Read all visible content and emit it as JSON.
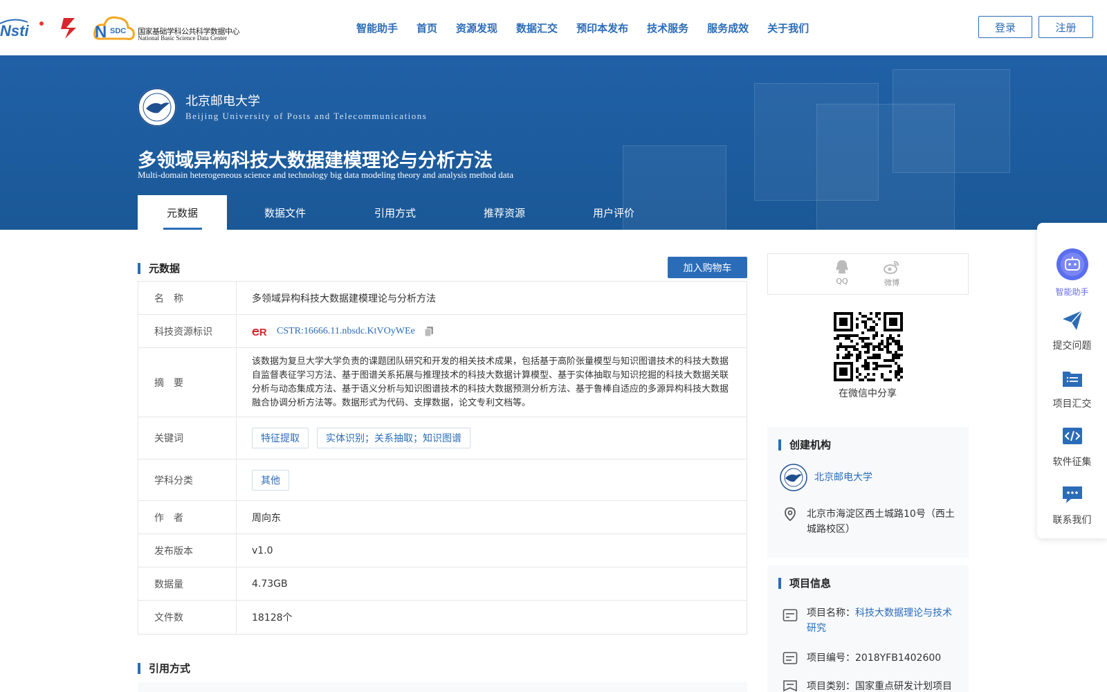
{
  "header": {
    "nsdc_cn": "国家基础学科公共科学数据中心",
    "nsdc_en": "National Basic Science Data Center",
    "nav": [
      "智能助手",
      "首页",
      "资源发现",
      "数据汇交",
      "预印本发布",
      "技术服务",
      "服务成效",
      "关于我们"
    ],
    "login": "登录",
    "register": "注册"
  },
  "banner": {
    "institution_cn": "北京邮电大学",
    "institution_en": "Beijing University of Posts and Telecommunications",
    "title_cn": "多领域异构科技大数据建模理论与分析方法",
    "title_en": "Multi-domain heterogeneous science and technology big data modeling theory and analysis method data",
    "tabs": [
      "元数据",
      "数据文件",
      "引用方式",
      "推荐资源",
      "用户评价"
    ]
  },
  "metadata": {
    "heading": "元数据",
    "cart_button": "加入购物车",
    "rows": {
      "name_label": "名　称",
      "name_value": "多领域异构科技大数据建模理论与分析方法",
      "cstr_label": "科技资源标识",
      "cstr_value": "CSTR:16666.11.nbsdc.KtVOyWEe",
      "abstract_label": "摘　要",
      "abstract_value": "该数据为复旦大学大学负责的课题团队研究和开发的相关技术成果，包括基于高阶张量模型与知识图谱技术的科技大数据自监督表征学习方法、基于图谱关系拓展与推理技术的科技大数据计算模型、基于实体抽取与知识挖掘的科技大数据关联分析与动态集成方法、基于语义分析与知识图谱技术的科技大数据预测分析方法、基于鲁棒自适应的多源异构科技大数据融合协调分析方法等。数据形式为代码、支撑数据，论文专利文档等。",
      "keywords_label": "关键词",
      "keyword_1": "特征提取",
      "keyword_2": "实体识别；关系抽取；知识图谱",
      "subject_label": "学科分类",
      "subject_value": "其他",
      "author_label": "作　者",
      "author_value": "周向东",
      "version_label": "发布版本",
      "version_value": "v1.0",
      "size_label": "数据量",
      "size_value": "4.73GB",
      "files_label": "文件数",
      "files_value": "18128个"
    }
  },
  "citation": {
    "heading": "引用方式"
  },
  "share": {
    "qq": "QQ",
    "weibo": "微博",
    "wechat_caption": "在微信中分享"
  },
  "creator": {
    "heading": "创建机构",
    "name": "北京邮电大学",
    "address": "北京市海淀区西土城路10号（西土城路校区）"
  },
  "project": {
    "heading": "项目信息",
    "name_label": "项目名称：",
    "name_value": "科技大数据理论与技术研究",
    "code_label": "项目编号：",
    "code_value": "2018YFB1402600",
    "type_label": "项目类别：",
    "type_value": "国家重点研发计划项目"
  },
  "floatbar": {
    "assistant": "智能助手",
    "submit": "提交问题",
    "project": "项目汇交",
    "software": "软件征集",
    "contact": "联系我们"
  },
  "colors": {
    "primary": "#2b6cb8",
    "banner": "#1f5fa3",
    "assistant": "#6b6cf0"
  }
}
